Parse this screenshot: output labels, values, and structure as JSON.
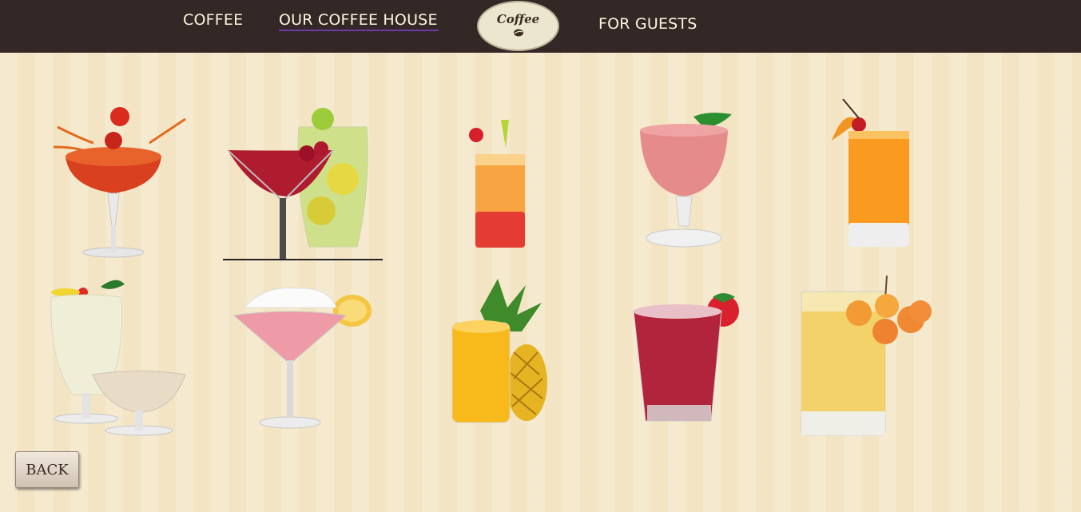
{
  "nav": {
    "coffee_label": "COFFEE",
    "house_label": "OUR COFFEE HOUSE",
    "guests_label": "FOR GUESTS",
    "logo_text": "Coffee"
  },
  "drinks": [
    {
      "name": "tomato-cocktail"
    },
    {
      "name": "berry-martini-and-mojito"
    },
    {
      "name": "tequila-sunrise"
    },
    {
      "name": "strawberry-smoothie"
    },
    {
      "name": "orange-juice"
    },
    {
      "name": "pina-colada"
    },
    {
      "name": "strawberry-cream-martini"
    },
    {
      "name": "pineapple-juice"
    },
    {
      "name": "strawberry-lemonade"
    },
    {
      "name": "apricot-juice"
    }
  ],
  "back_label": "BACK"
}
